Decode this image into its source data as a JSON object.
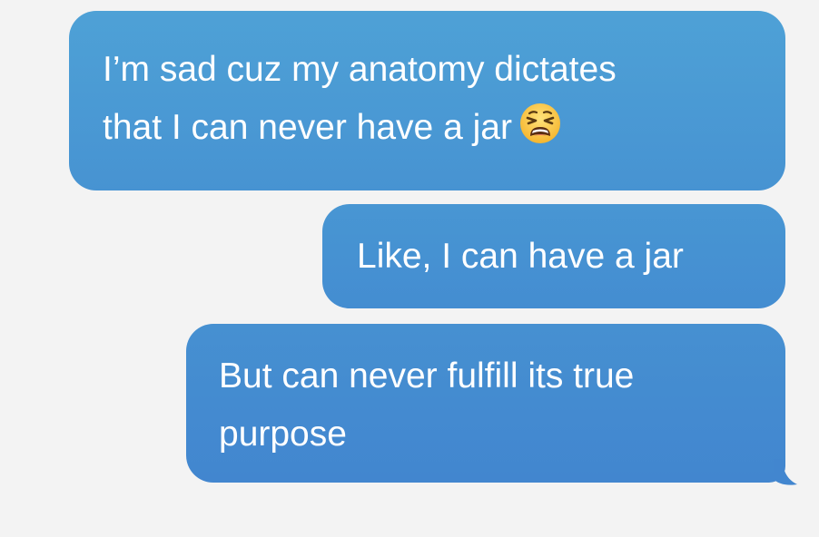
{
  "messages": [
    {
      "lines": [
        "I’m sad cuz my anatomy dictates",
        "that I can never have a jar"
      ],
      "emoji": "weary-face"
    },
    {
      "lines": [
        "Like, I can have a jar"
      ]
    },
    {
      "lines": [
        "But can never fulfill its true",
        "purpose"
      ]
    }
  ],
  "colors": {
    "background": "#f3f3f3",
    "bubble_top": "#4ea1d6",
    "bubble_bottom": "#4286cf",
    "text": "#ffffff"
  }
}
